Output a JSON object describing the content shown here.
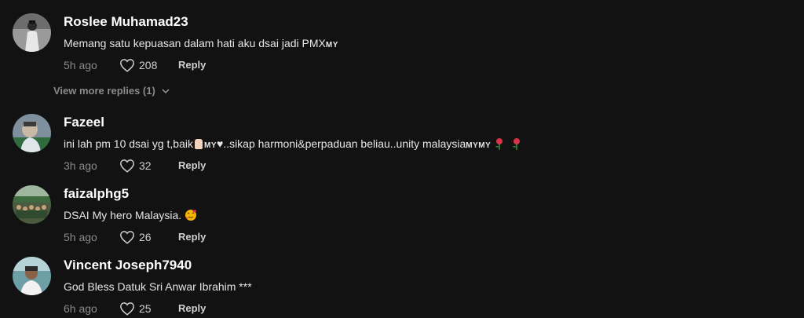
{
  "comments": [
    {
      "username": "Roslee Muhamad23",
      "text": "Memang satu kepuasan dalam hati aku dsai jadi PMX",
      "flag": "MY",
      "time": "5h ago",
      "likes": "208",
      "reply_label": "Reply",
      "view_more": "View more replies (1)"
    },
    {
      "username": "Fazeel",
      "text_a": "ini lah pm 10 dsai yg t,baik",
      "flag_a": "MY",
      "text_b": "♥..sikap harmoni&perpaduan beliau..unity malaysia",
      "flag_b": "MYMY",
      "time": "3h ago",
      "likes": "32",
      "reply_label": "Reply"
    },
    {
      "username": "faizalphg5",
      "text": "DSAI My hero Malaysia.",
      "time": "5h ago",
      "likes": "26",
      "reply_label": "Reply"
    },
    {
      "username": "Vincent Joseph7940",
      "text": "God Bless Datuk Sri Anwar Ibrahim ***",
      "time": "6h ago",
      "likes": "25",
      "reply_label": "Reply"
    }
  ],
  "colors": {
    "background": "#121212",
    "muted": "#8a8a8a",
    "text": "#e6e6e6"
  },
  "icons": [
    "heart-icon",
    "chevron-down-icon",
    "rose-emoji",
    "thumbs-up-emoji",
    "love-face-emoji"
  ]
}
